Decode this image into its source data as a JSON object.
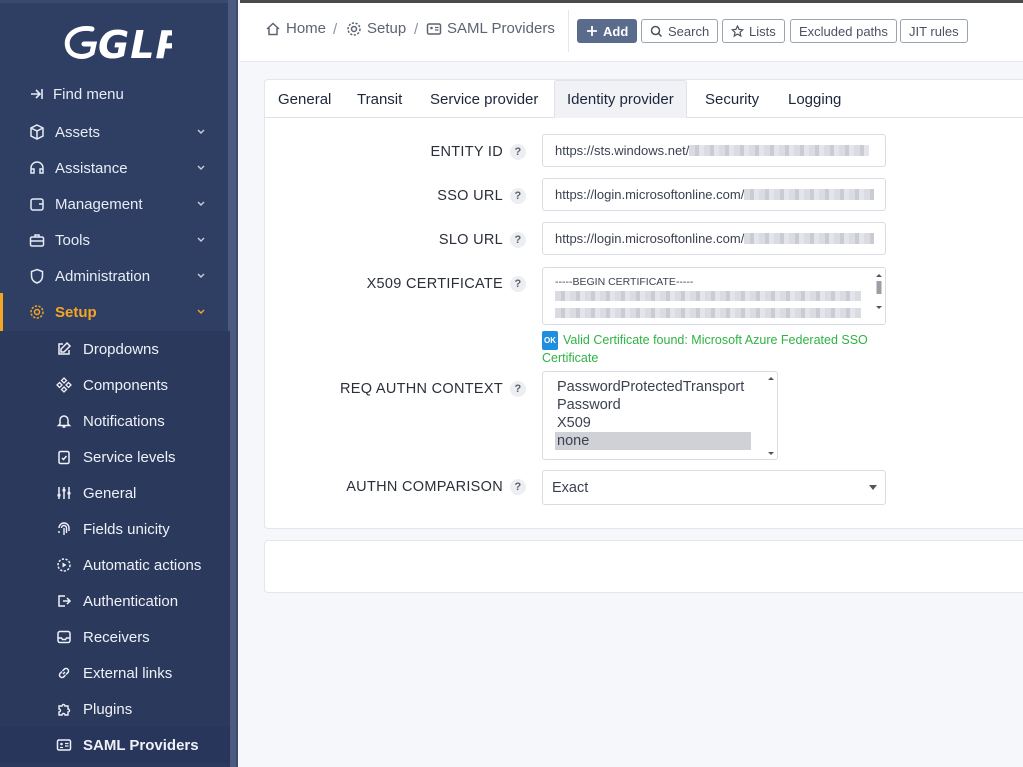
{
  "app": {
    "logo_text": "GLPI"
  },
  "sidebar": {
    "find_menu": "Find menu",
    "items": [
      {
        "label": "Assets",
        "icon": "cube-icon"
      },
      {
        "label": "Assistance",
        "icon": "headset-icon"
      },
      {
        "label": "Management",
        "icon": "wallet-icon"
      },
      {
        "label": "Tools",
        "icon": "briefcase-icon"
      },
      {
        "label": "Administration",
        "icon": "shield-icon"
      },
      {
        "label": "Setup",
        "icon": "gear-icon"
      }
    ],
    "setup_items": [
      {
        "label": "Dropdowns"
      },
      {
        "label": "Components"
      },
      {
        "label": "Notifications"
      },
      {
        "label": "Service levels"
      },
      {
        "label": "General"
      },
      {
        "label": "Fields unicity"
      },
      {
        "label": "Automatic actions"
      },
      {
        "label": "Authentication"
      },
      {
        "label": "Receivers"
      },
      {
        "label": "External links"
      },
      {
        "label": "Plugins"
      },
      {
        "label": "SAML Providers"
      }
    ]
  },
  "breadcrumb": {
    "home": "Home",
    "setup": "Setup",
    "current": "SAML Providers",
    "separator": "/"
  },
  "toolbar": {
    "add": "Add",
    "search": "Search",
    "lists": "Lists",
    "excluded_paths": "Excluded paths",
    "jit_rules": "JIT rules"
  },
  "tabs": [
    "General",
    "Transit",
    "Service provider",
    "Identity provider",
    "Security",
    "Logging"
  ],
  "form": {
    "entity_id": {
      "label": "ENTITY ID",
      "value": "https://sts.windows.net/"
    },
    "sso_url": {
      "label": "SSO URL",
      "value": "https://login.microsoftonline.com/"
    },
    "slo_url": {
      "label": "SLO URL",
      "value": "https://login.microsoftonline.com/"
    },
    "x509": {
      "label": "X509 CERTIFICATE",
      "value": "-----BEGIN CERTIFICATE-----"
    },
    "cert_status": {
      "badge": "OK",
      "text": "Valid Certificate found: Microsoft Azure Federated SSO Certificate"
    },
    "req_authn_context": {
      "label": "REQ AUTHN CONTEXT",
      "options": [
        "PasswordProtectedTransport",
        "Password",
        "X509",
        "none"
      ],
      "selected": "none"
    },
    "authn_comparison": {
      "label": "AUTHN COMPARISON",
      "value": "Exact"
    },
    "help_mark": "?"
  },
  "colors": {
    "sidebar_bg": "#2f3f64",
    "accent": "#f5a524",
    "ok_green": "#2fb344",
    "primary_btn": "#5b6b8c"
  }
}
